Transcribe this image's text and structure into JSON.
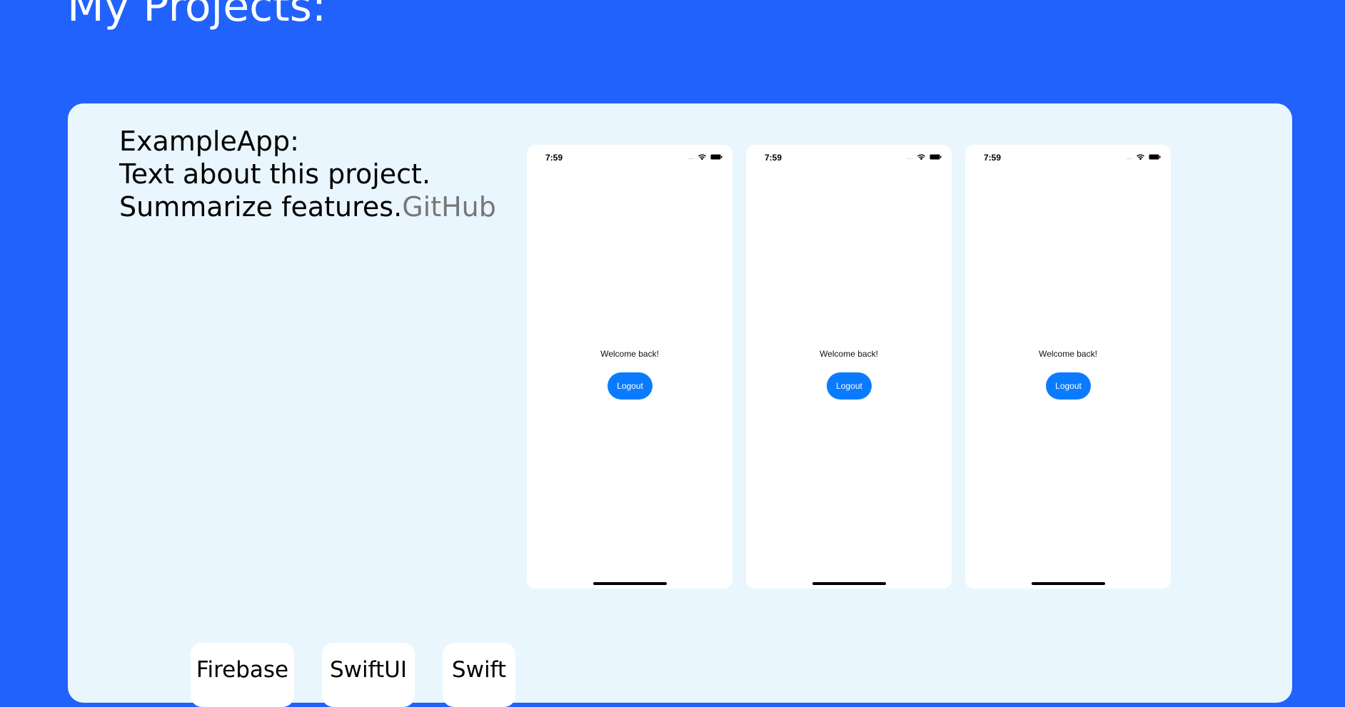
{
  "page": {
    "heading": "My Projects:"
  },
  "project": {
    "title": "ExampleApp:",
    "description": "Text about this project.",
    "features": "Summarize features.",
    "github_link": "GitHub",
    "screens": [
      {
        "time": "7:59",
        "signal": "....",
        "welcome": "Welcome back!",
        "button": "Logout"
      },
      {
        "time": "7:59",
        "signal": "....",
        "welcome": "Welcome back!",
        "button": "Logout"
      },
      {
        "time": "7:59",
        "signal": "....",
        "welcome": "Welcome back!",
        "button": "Logout"
      }
    ],
    "tags": [
      "Firebase",
      "SwiftUI",
      "Swift"
    ]
  },
  "icons": {
    "status": [
      "cellular-signal-icon",
      "wifi-icon",
      "battery-icon"
    ]
  },
  "colors": {
    "background": "#2062fb",
    "card": "#eaf6fe",
    "link": "#777777",
    "button": "#0a7bfe"
  }
}
